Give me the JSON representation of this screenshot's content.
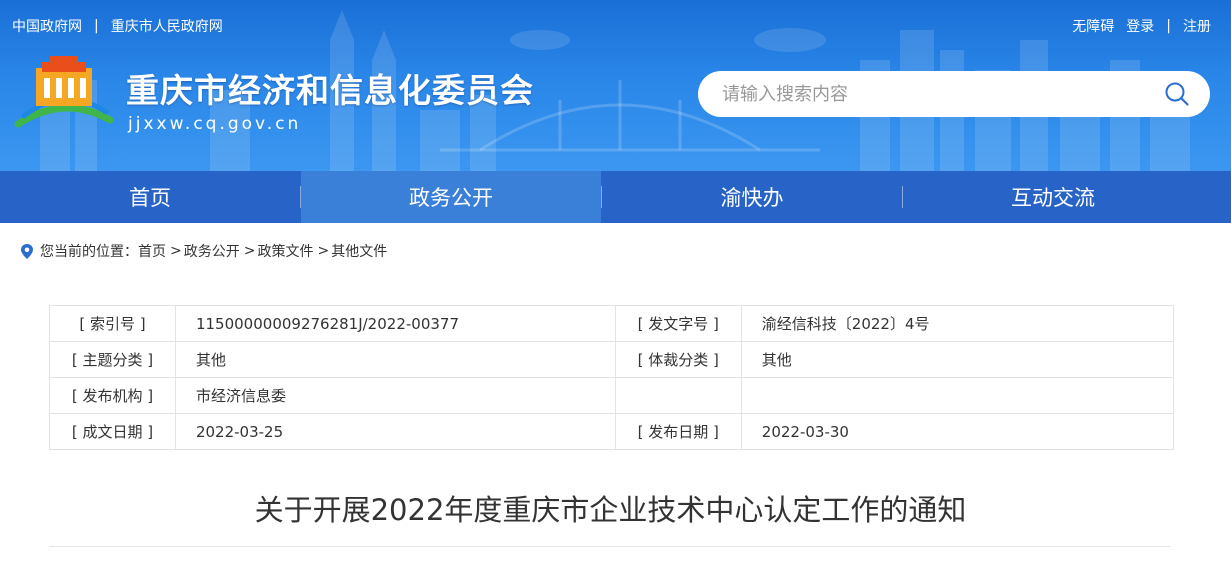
{
  "header": {
    "top_links": [
      "中国政府网",
      "重庆市人民政府网"
    ],
    "user_links": [
      "无障碍",
      "登录",
      "注册"
    ],
    "separator": "|",
    "site_title": "重庆市经济和信息化委员会",
    "site_domain": "jjxxw.cq.gov.cn",
    "search_placeholder": "请输入搜索内容",
    "search_icon": "search-icon",
    "logo_icon": "chongqing-emblem-icon"
  },
  "nav": {
    "items": [
      "首页",
      "政务公开",
      "渝快办",
      "互动交流"
    ],
    "active": "政务公开"
  },
  "breadcrumb": {
    "prefix": "您当前的位置：",
    "items": [
      "首页",
      "政务公开",
      "政策文件",
      "其他文件"
    ],
    "sep": ">",
    "icon": "location-pin-icon"
  },
  "meta": {
    "rows": [
      [
        {
          "label": "[ 索引号 ]",
          "value": "11500000009276281J/2022-00377"
        },
        {
          "label": "[ 发文字号 ]",
          "value": "渝经信科技〔2022〕4号"
        }
      ],
      [
        {
          "label": "[ 主题分类 ]",
          "value": "其他"
        },
        {
          "label": "[ 体裁分类 ]",
          "value": "其他"
        }
      ],
      [
        {
          "label": "[ 发布机构 ]",
          "value": "市经济信息委"
        },
        {
          "label": "",
          "value": ""
        }
      ],
      [
        {
          "label": "[ 成文日期 ]",
          "value": "2022-03-25"
        },
        {
          "label": "[ 发布日期 ]",
          "value": "2022-03-30"
        }
      ]
    ]
  },
  "document": {
    "title": "关于开展2022年度重庆市企业技术中心认定工作的通知"
  },
  "colors": {
    "header_blue": "#2a86e8",
    "nav_blue": "#2864c8",
    "nav_active": "#3a7fd8"
  }
}
